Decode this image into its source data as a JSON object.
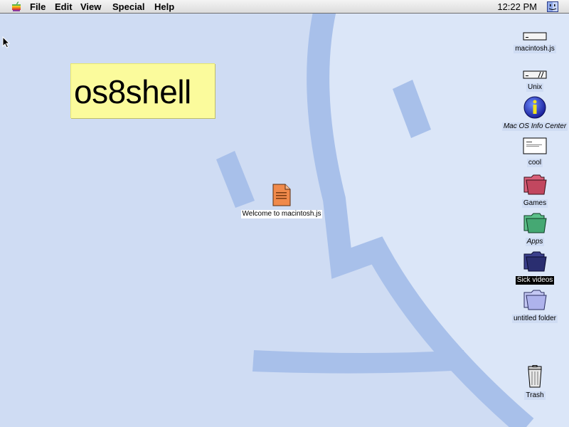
{
  "menubar": {
    "items": [
      "File",
      "Edit",
      "View",
      "Special",
      "Help"
    ],
    "clock": "12:22 PM"
  },
  "sticky_note": {
    "text": "os8shell"
  },
  "desktop_icons": {
    "welcome_doc": {
      "label": "Welcome to macintosh.js",
      "icon": "document-icon"
    },
    "macintosh_js": {
      "label": "macintosh.js",
      "icon": "hard-disk-icon"
    },
    "unix": {
      "label": "Unix",
      "icon": "hard-disk-icon"
    },
    "info_center": {
      "label": "Mac OS Info Center",
      "icon": "info-icon"
    },
    "cool": {
      "label": "cool",
      "icon": "document-preview-icon"
    },
    "games": {
      "label": "Games",
      "icon": "folder-icon"
    },
    "apps": {
      "label": "Apps",
      "icon": "folder-icon"
    },
    "sick_videos": {
      "label": "Sick videos",
      "icon": "folder-icon",
      "selected": true
    },
    "untitled_folder": {
      "label": "untitled folder",
      "icon": "folder-icon"
    },
    "trash": {
      "label": "Trash",
      "icon": "trash-icon"
    }
  },
  "colors": {
    "desktop": "#cfdcf3",
    "face_light": "#dbe6f8",
    "face_stroke": "#a8c0ea",
    "sticky": "#fbfb9c",
    "games_folder": "#d9607a",
    "apps_folder": "#5cc08a",
    "sick_videos_folder": "#3a3f8c",
    "untitled_folder": "#c4c8f4",
    "welcome_doc": "#f08a4b"
  }
}
